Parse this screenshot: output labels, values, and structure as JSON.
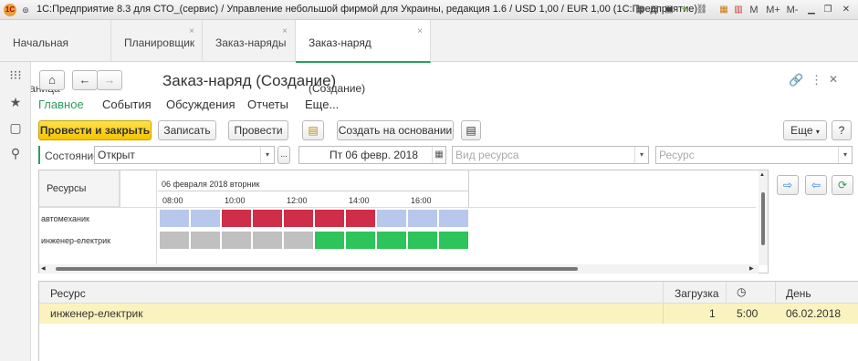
{
  "window": {
    "title": "1С:Предприятие 8.3 для СТО_(сервис) / Управление небольшой фирмой для Украины, редакция 1.6 / USD 1,00 / EUR 1,00  (1С:Предприятие)",
    "m_label": "M",
    "m_plus": "M+",
    "m_minus": "M-"
  },
  "tabs": [
    {
      "label": "Начальная страница",
      "close": ""
    },
    {
      "label": "Планировщик",
      "close": "×"
    },
    {
      "label": "Заказ-наряды",
      "close": "×"
    },
    {
      "label": "Заказ-наряд (Создание)",
      "close": "×"
    }
  ],
  "form": {
    "title": "Заказ-наряд (Создание)",
    "nav": [
      "Главное",
      "События",
      "Обсуждения",
      "Отчеты",
      "Еще..."
    ],
    "buttons": {
      "post_close": "Провести и закрыть",
      "save": "Записать",
      "post": "Провести",
      "create_based": "Создать на основании",
      "more": "Еще"
    },
    "state_label": "Состояние:",
    "state_value": "Открыт",
    "date_value": "Пт 06 февр. 2018",
    "resource_kind_placeholder": "Вид ресурса",
    "resource_placeholder": "Ресурс",
    "ellipsis": "..."
  },
  "schedule": {
    "col_header": "Ресурсы",
    "date_header": "06 февраля 2018 вторник",
    "hours": [
      "08:00",
      "10:00",
      "12:00",
      "14:00",
      "16:00"
    ],
    "rows": [
      {
        "name": "автомеханик",
        "slots": [
          "free",
          "free",
          "busy",
          "busy",
          "busy",
          "busy",
          "busy",
          "free",
          "free",
          "free"
        ]
      },
      {
        "name": "инженер-електрик",
        "slots": [
          "grey",
          "grey",
          "grey",
          "grey",
          "grey",
          "green",
          "green",
          "green",
          "green",
          "green"
        ]
      }
    ],
    "colors": {
      "free": "#b8c8ec",
      "busy": "#cf2e48",
      "grey": "#c0c0c0",
      "green": "#2dc45a"
    }
  },
  "resource_table": {
    "headers": {
      "resource": "Ресурс",
      "load": "Загрузка",
      "day": "День"
    },
    "rows": [
      {
        "resource": "инженер-електрик",
        "load": "1",
        "time": "5:00",
        "day": "06.02.2018"
      }
    ]
  }
}
